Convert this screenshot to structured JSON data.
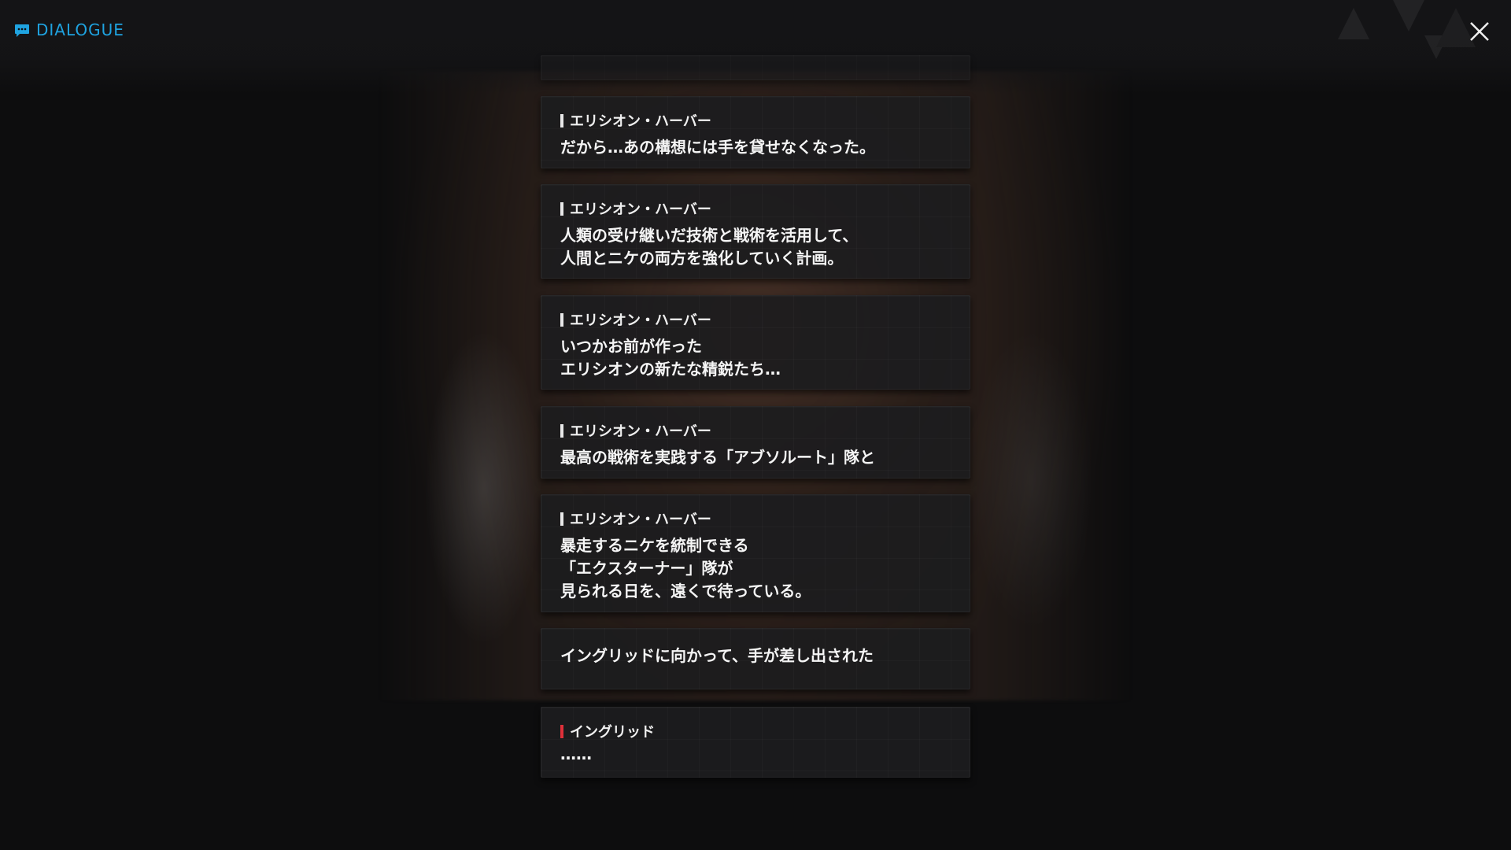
{
  "header": {
    "title": "DIALOGUE",
    "accent_color": "#1fa3e0",
    "icons": {
      "title": "chat-bubble-icon",
      "close": "close-icon"
    }
  },
  "dialogue": [
    {
      "speaker": "エリシオン・ハーバー",
      "text": "だから…あの構想には手を貸せなくなった。",
      "speaker_color": "#e8e8e8"
    },
    {
      "speaker": "エリシオン・ハーバー",
      "text": "人類の受け継いだ技術と戦術を活用して、\n人間とニケの両方を強化していく計画。",
      "speaker_color": "#e8e8e8"
    },
    {
      "speaker": "エリシオン・ハーバー",
      "text": "いつかお前が作った\nエリシオンの新たな精鋭たち…",
      "speaker_color": "#e8e8e8"
    },
    {
      "speaker": "エリシオン・ハーバー",
      "text": "最高の戦術を実践する「アブソルート」隊と",
      "speaker_color": "#e8e8e8"
    },
    {
      "speaker": "エリシオン・ハーバー",
      "text": "暴走するニケを統制できる\n「エクスターナー」隊が\n見られる日を、遠くで待っている。",
      "speaker_color": "#e8e8e8"
    },
    {
      "speaker": "",
      "text": "イングリッドに向かって、手が差し出された"
    },
    {
      "speaker": "イングリッド",
      "text": "……",
      "speaker_color": "#e0303a"
    }
  ]
}
